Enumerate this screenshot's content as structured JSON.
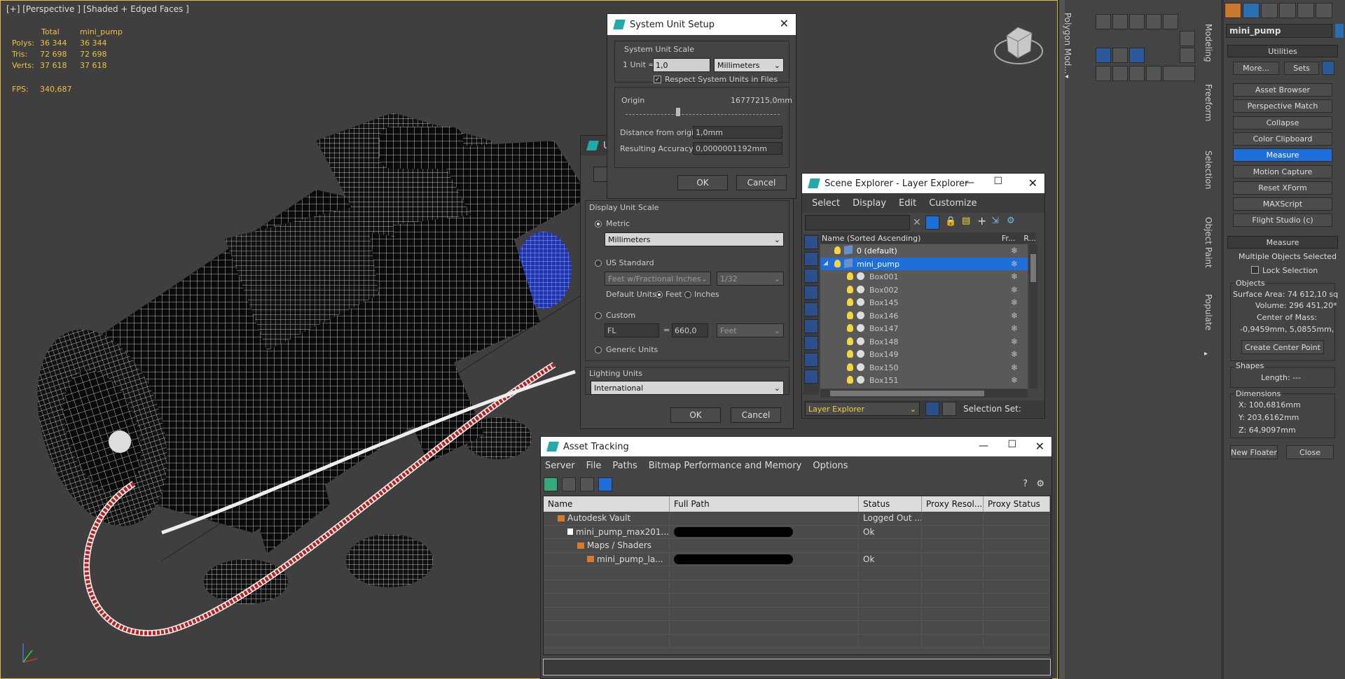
{
  "viewport": {
    "label": "[+] [Perspective ] [Shaded + Edged Faces ]",
    "stats": {
      "headers": [
        "Total",
        "mini_pump"
      ],
      "rows": [
        {
          "label": "Polys:",
          "total": "36 344",
          "obj": "36 344"
        },
        {
          "label": "Tris:",
          "total": "72 698",
          "obj": "72 698"
        },
        {
          "label": "Verts:",
          "total": "37 618",
          "obj": "37 618"
        }
      ],
      "fps_label": "FPS:",
      "fps_value": "340,687"
    }
  },
  "system_unit_dialog": {
    "title": "System Unit Setup",
    "group": "System Unit Scale",
    "unit_label": "1 Unit =",
    "unit_value": "1,0",
    "unit_type": "Millimeters",
    "respect_label": "Respect System Units in Files",
    "origin_label": "Origin",
    "origin_value": "16777215,0mm",
    "distance_label": "Distance from origin:",
    "distance_value": "1,0mm",
    "accuracy_label": "Resulting Accuracy:",
    "accuracy_value": "0,0000001192mm",
    "ok": "OK",
    "cancel": "Cancel"
  },
  "units_dialog": {
    "title_partial": "U",
    "display_group": "Display Unit Scale",
    "metric": "Metric",
    "metric_value": "Millimeters",
    "us_standard": "US Standard",
    "us_value": "Feet w/Fractional Inches",
    "us_fraction": "1/32",
    "default_units": "Default Units:",
    "feet": "Feet",
    "inches": "Inches",
    "custom": "Custom",
    "custom_name": "FL",
    "custom_eq": "=",
    "custom_value": "660,0",
    "custom_unit": "Feet",
    "generic": "Generic Units",
    "lighting_group": "Lighting Units",
    "lighting_value": "International",
    "ok": "OK",
    "cancel": "Cancel"
  },
  "scene_explorer": {
    "title": "Scene Explorer - Layer Explorer",
    "menu": [
      "Select",
      "Display",
      "Edit",
      "Customize"
    ],
    "columns": {
      "name": "Name (Sorted Ascending)",
      "fr": "Fr...",
      "r": "R..."
    },
    "rows": [
      {
        "name": "0 (default)",
        "kind": "layer",
        "selected": false
      },
      {
        "name": "mini_pump",
        "kind": "layer",
        "selected": true
      },
      {
        "name": "Box001",
        "kind": "obj",
        "selected": false
      },
      {
        "name": "Box002",
        "kind": "obj",
        "selected": false
      },
      {
        "name": "Box145",
        "kind": "obj",
        "selected": false
      },
      {
        "name": "Box146",
        "kind": "obj",
        "selected": false
      },
      {
        "name": "Box147",
        "kind": "obj",
        "selected": false
      },
      {
        "name": "Box148",
        "kind": "obj",
        "selected": false
      },
      {
        "name": "Box149",
        "kind": "obj",
        "selected": false
      },
      {
        "name": "Box150",
        "kind": "obj",
        "selected": false
      },
      {
        "name": "Box151",
        "kind": "obj",
        "selected": false
      }
    ],
    "footer_explorer": "Layer Explorer",
    "selection_sets": "Selection Set:"
  },
  "asset_tracking": {
    "title": "Asset Tracking",
    "menu": [
      "Server",
      "File",
      "Paths",
      "Bitmap Performance and Memory",
      "Options"
    ],
    "columns": [
      "Name",
      "Full Path",
      "Status",
      "Proxy Resol...",
      "Proxy Status"
    ],
    "rows": [
      {
        "name": "Autodesk Vault",
        "path": "",
        "status": "Logged Out ...",
        "indent": 1,
        "redacted": false
      },
      {
        "name": "mini_pump_max201...",
        "path": "",
        "status": "Ok",
        "indent": 2,
        "redacted": true
      },
      {
        "name": "Maps / Shaders",
        "path": "",
        "status": "",
        "indent": 3,
        "redacted": false
      },
      {
        "name": "mini_pump_la...",
        "path": "",
        "status": "Ok",
        "indent": 4,
        "redacted": true
      }
    ]
  },
  "right_panel": {
    "object_name": "mini_pump",
    "tabs_vertical": [
      "Polygon Mod...",
      "Modeling",
      "Freeform",
      "Selection",
      "Object Paint",
      "Populate"
    ],
    "utilities_title": "Utilities",
    "more": "More...",
    "sets": "Sets",
    "utility_buttons": [
      "Asset Browser",
      "Perspective Match",
      "Collapse",
      "Color Clipboard",
      "Measure",
      "Motion Capture",
      "Reset XForm",
      "MAXScript",
      "Flight Studio (c)"
    ],
    "active_utility": "Measure",
    "measure_title": "Measure",
    "multiple_selected": "Multiple Objects Selected",
    "lock_selection": "Lock Selection",
    "objects_label": "Objects",
    "surface_area": "Surface Area:  74 612,10 sq",
    "volume": "Volume:  296 451,20*",
    "center_label": "Center of Mass:",
    "center_value": "-0,9459mm, 5,0855mm,",
    "create_center": "Create Center Point",
    "shapes_label": "Shapes",
    "length": "Length:  ---",
    "dimensions_label": "Dimensions",
    "dim_x": "X:   100,6816mm",
    "dim_y": "Y:   203,6162mm",
    "dim_z": "Z:   64,9097mm",
    "new_floater": "New Floater",
    "close": "Close"
  },
  "colors": {
    "selection_blue": "#1e6fd9",
    "stat_yellow": "#f0c040",
    "viewport_border": "#e0b94a"
  }
}
